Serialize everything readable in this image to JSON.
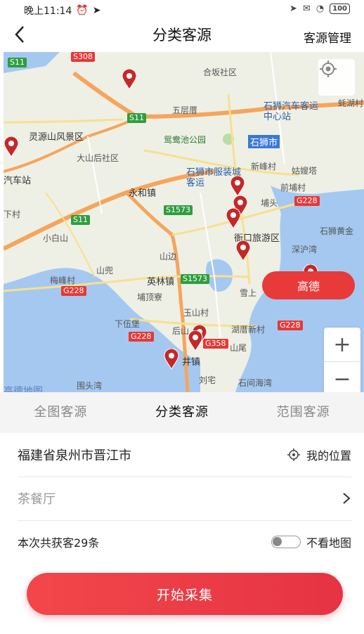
{
  "status_bar": {
    "time": "晚上11:14",
    "battery": "100"
  },
  "nav": {
    "back_icon": "chevron-left-icon",
    "title": "分类客源",
    "action": "客源管理"
  },
  "map": {
    "labels": [
      "合坂社区",
      "五层厝",
      "石狮汽车客运中心站",
      "灵源山风景区",
      "鸳鸯池公园",
      "石狮市",
      "大山后社区",
      "新峰村",
      "姑嫂塔",
      "石狮市服装城客运",
      "永和镇",
      "前埔村",
      "埔头",
      "小白山",
      "衙口旅游区",
      "深沪湾",
      "石狮黄金",
      "山边",
      "山兜",
      "英林镇",
      "梅峰村",
      "埔顶寮",
      "雪上",
      "玉山村",
      "下伍堡",
      "后山",
      "湖厝新村",
      "山尾",
      "井镇",
      "刘宅",
      "石间海湾",
      "围头湾",
      "汽车站",
      "下村",
      "蚝湖村"
    ],
    "roads": [
      "S11",
      "S11",
      "S1573",
      "S1573",
      "S11",
      "G228",
      "G228",
      "G228",
      "G228",
      "G358",
      "S308"
    ],
    "gaode_label": "高德",
    "logo": "高德地图",
    "zoom_in": "+",
    "zoom_out": "−"
  },
  "tabs": [
    {
      "label": "全图客源",
      "active": false
    },
    {
      "label": "分类客源",
      "active": true
    },
    {
      "label": "范围客源",
      "active": false
    }
  ],
  "location": {
    "text": "福建省泉州市晋江市",
    "my_location": "我的位置"
  },
  "category": {
    "text": "茶餐厅"
  },
  "summary": {
    "text": "本次共获客29条",
    "hide_map": "不看地图"
  },
  "start_button": "开始采集",
  "colors": {
    "accent": "#e93a3a",
    "water": "#a5c8f0",
    "road_major": "#f6a55c"
  }
}
